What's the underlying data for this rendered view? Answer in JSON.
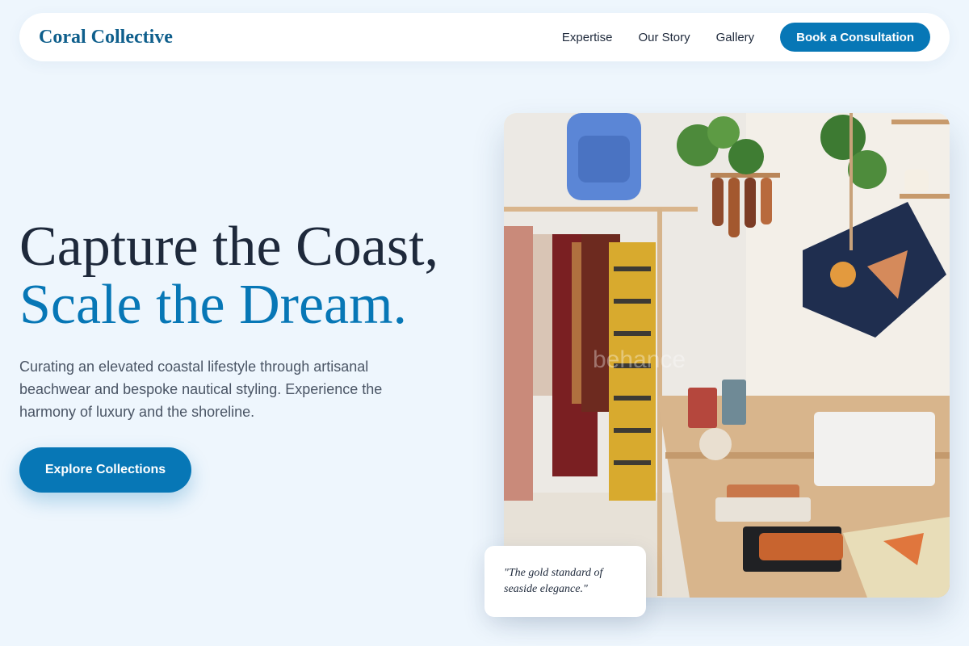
{
  "header": {
    "brand": "Coral Collective",
    "nav": [
      "Expertise",
      "Our Story",
      "Gallery"
    ],
    "cta": "Book a Consultation"
  },
  "hero": {
    "headline_line1": "Capture the Coast,",
    "headline_line2": "Scale the Dream.",
    "subtext": "Curating an elevated coastal lifestyle through artisanal beachwear and bespoke nautical styling. Experience the harmony of luxury and the shoreline.",
    "button": "Explore Collections",
    "image_watermark": "behance"
  },
  "quote": {
    "text": "\"The gold standard of seaside elegance.\""
  },
  "colors": {
    "accent": "#0777b6",
    "brand": "#0f5f8c",
    "background": "#eef6fd",
    "heading": "#1e293b"
  }
}
